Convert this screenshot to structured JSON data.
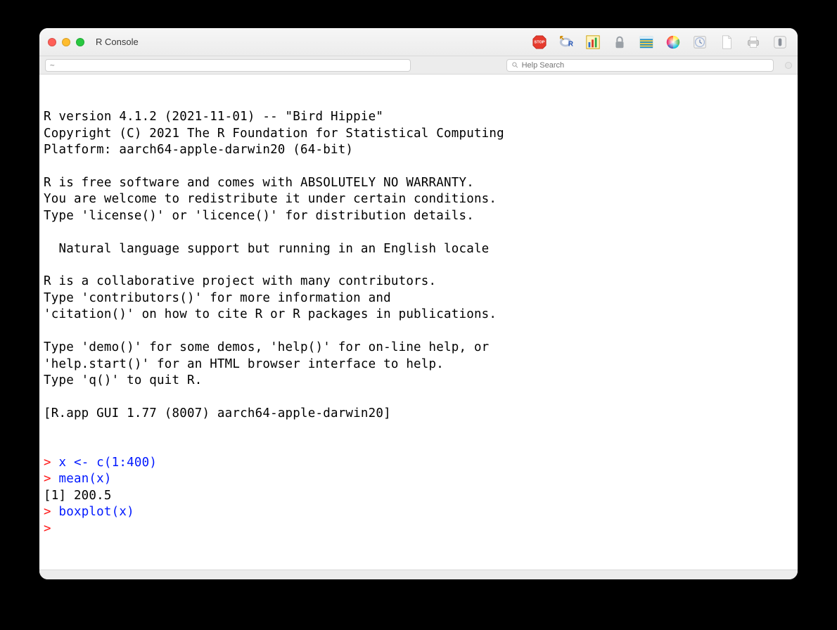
{
  "window": {
    "title": "R Console"
  },
  "path_input": {
    "value": "~"
  },
  "help_search": {
    "placeholder": "Help Search"
  },
  "banner": [
    "",
    "R version 4.1.2 (2021-11-01) -- \"Bird Hippie\"",
    "Copyright (C) 2021 The R Foundation for Statistical Computing",
    "Platform: aarch64-apple-darwin20 (64-bit)",
    "",
    "R is free software and comes with ABSOLUTELY NO WARRANTY.",
    "You are welcome to redistribute it under certain conditions.",
    "Type 'license()' or 'licence()' for distribution details.",
    "",
    "  Natural language support but running in an English locale",
    "",
    "R is a collaborative project with many contributors.",
    "Type 'contributors()' for more information and",
    "'citation()' on how to cite R or R packages in publications.",
    "",
    "Type 'demo()' for some demos, 'help()' for on-line help, or",
    "'help.start()' for an HTML browser interface to help.",
    "Type 'q()' to quit R.",
    "",
    "[R.app GUI 1.77 (8007) aarch64-apple-darwin20]",
    "",
    ""
  ],
  "session": [
    {
      "type": "input",
      "prompt": "> ",
      "text": "x <- c(1:400)"
    },
    {
      "type": "input",
      "prompt": "> ",
      "text": "mean(x)"
    },
    {
      "type": "output",
      "text": "[1] 200.5"
    },
    {
      "type": "input",
      "prompt": "> ",
      "text": "boxplot(x)"
    },
    {
      "type": "input",
      "prompt": "> ",
      "text": ""
    }
  ],
  "toolbar_icons": [
    "stop-icon",
    "run-r-icon",
    "plot-icon",
    "lock-icon",
    "data-icon",
    "color-picker-icon",
    "history-icon",
    "new-doc-icon",
    "print-icon",
    "quartz-icon"
  ]
}
